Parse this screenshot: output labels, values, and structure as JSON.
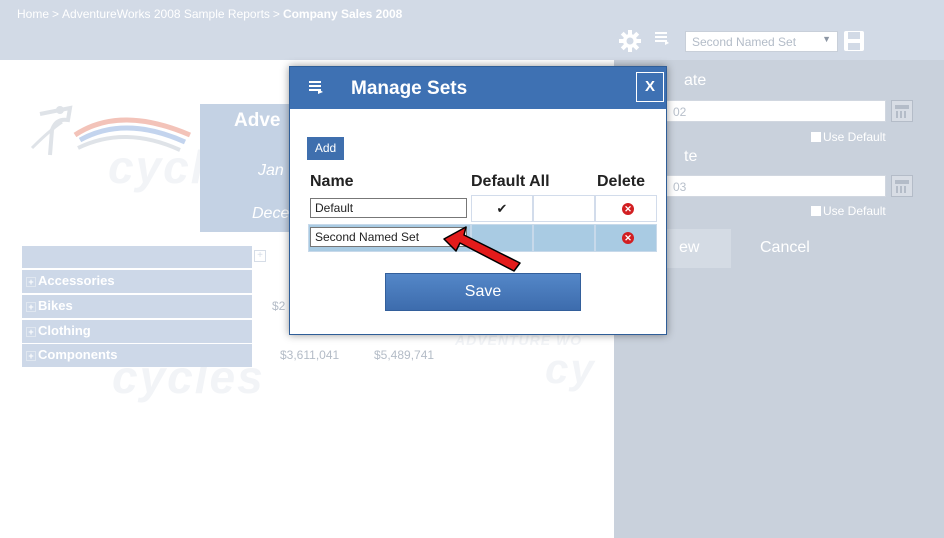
{
  "breadcrumb": {
    "items": [
      "Home",
      "AdventureWorks 2008 Sample Reports"
    ],
    "separator": ">",
    "current": "Company Sales 2008"
  },
  "toolbar": {
    "selected_set": "Second Named Set",
    "icons": [
      "gear-icon",
      "list-icon",
      "save-icon"
    ]
  },
  "params": {
    "start_label": "ate",
    "start_value": "02",
    "start_use_default": "Use Default",
    "end_label": "te",
    "end_value": "03",
    "end_use_default": "Use Default",
    "view_label": "ew",
    "cancel_label": "Cancel"
  },
  "report": {
    "title": "Adve",
    "subtitle_1": "Jan",
    "subtitle_2": "Dece",
    "watermark_1": "cycles",
    "watermark_2": "cy",
    "watermark_3": "cycles",
    "watermark_4": "ADVENTURE WO",
    "rows": [
      "Accessories",
      "Bikes",
      "Clothing",
      "Components"
    ],
    "cells": {
      "bikes_partial": "$2",
      "components_1": "$3,611,041",
      "components_2": "$5,489,741"
    }
  },
  "modal": {
    "title": "Manage Sets",
    "close_label": "X",
    "add_label": "Add",
    "columns": [
      "Name",
      "Default All",
      "Delete"
    ],
    "sets": [
      {
        "name": "Default",
        "default_all": "✔",
        "selected": false
      },
      {
        "name": "Second Named Set",
        "default_all": "",
        "selected": true
      }
    ],
    "save_label": "Save"
  },
  "colors": {
    "header_blue": "#3e71b3",
    "selected_row": "#a9cbe3",
    "delete_red": "#d21f22",
    "arrow_red": "#e31b1b"
  }
}
